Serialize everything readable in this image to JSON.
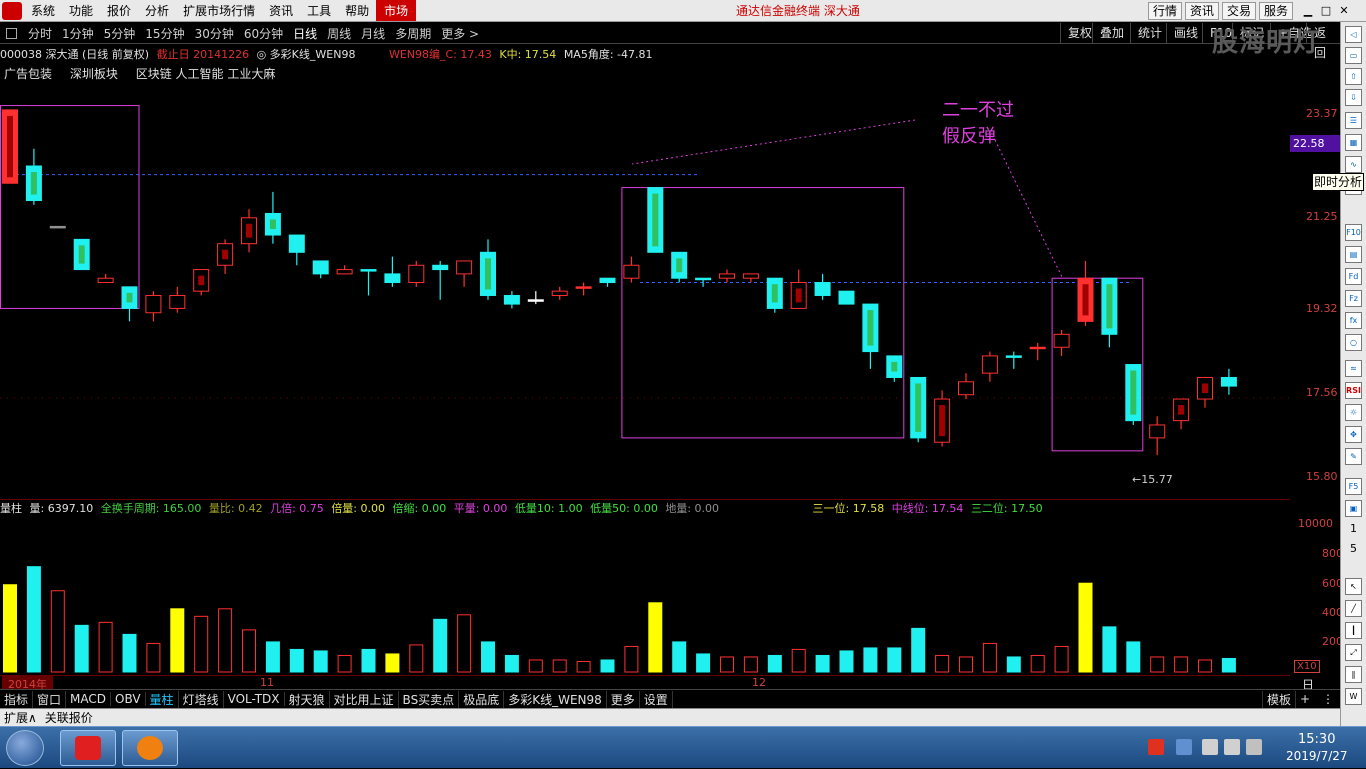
{
  "menu": {
    "items": [
      "系统",
      "功能",
      "报价",
      "分析",
      "扩展市场行情",
      "资讯",
      "工具",
      "帮助"
    ],
    "active_item": "市场",
    "brand": "通达信金融终端  深大通",
    "right_buttons": [
      "行情",
      "资讯",
      "交易",
      "服务"
    ]
  },
  "periods": {
    "items": [
      "分时",
      "1分钟",
      "5分钟",
      "15分钟",
      "30分钟",
      "60分钟",
      "日线",
      "周线",
      "月线",
      "多周期",
      "更多 >"
    ],
    "active": "日线",
    "right": [
      "复权",
      "叠加",
      "统计",
      "画线",
      "F10",
      "标记",
      "+自选",
      "返回"
    ]
  },
  "info": {
    "code_name": "000038 深大通 (日线 前复权)",
    "cutoff": "截止日 20141226",
    "indicator": "◎ 多彩K线_WEN98",
    "close_label": "WEN98编_C: 17.43",
    "kmid_label": "K中: 17.54",
    "ma5_label": "MA5角度: -47.81"
  },
  "blocks": [
    "广告包装",
    "深圳板块",
    "区块链 人工智能 工业大麻"
  ],
  "watermark": "股海明灯",
  "annotation": {
    "line1": "二一不过",
    "line2": "假反弹"
  },
  "price_axis": [
    "23.37",
    "21.25",
    "19.32",
    "17.56",
    "15.80"
  ],
  "current_price_tag": "22.58",
  "low_label": "←15.77",
  "volume_info": {
    "name": "量柱",
    "vol": "量: 6397.10",
    "full_turnover": "全换手周期: 165.00",
    "vol_ratio": "量比: 0.42",
    "multiple": "几倍: 0.75",
    "double": "倍量: 0.00",
    "half": "倍缩: 0.00",
    "flat": "平量: 0.00",
    "low10": "低量10: 1.00",
    "low50": "低量50: 0.00",
    "ground": "地量: 0.00",
    "third1": "三一位: 17.58",
    "mid": "中线位: 17.54",
    "third2": "三二位: 17.50"
  },
  "volume_axis": [
    "10000",
    "800",
    "600",
    "400",
    "200"
  ],
  "volume_axis_unit": "X10",
  "date_labels": {
    "year": "2014年",
    "m11": "11",
    "m12": "12",
    "period": "日线"
  },
  "tabs": [
    "指标",
    "窗口",
    "MACD",
    "OBV",
    "量柱",
    "灯塔线",
    "VOL-TDX",
    "射天狼",
    "对比用上证",
    "BS买卖点",
    "极品底",
    "多彩K线_WEN98",
    "更多",
    "设置"
  ],
  "active_tab": "量柱",
  "tabs_right": "模板",
  "ext_bar": [
    "扩展∧",
    "关联报价"
  ],
  "tooltip": "即时分析",
  "clock": {
    "time": "15:30",
    "date": "2019/7/27"
  },
  "chart_data": {
    "type": "candlestick",
    "ylim": [
      15.0,
      24.5
    ],
    "candles": [
      {
        "o": 22.2,
        "c": 23.9,
        "h": 23.9,
        "l": 22.2,
        "color": "red"
      },
      {
        "o": 22.6,
        "c": 21.8,
        "h": 23.0,
        "l": 21.7,
        "color": "cyan"
      },
      {
        "o": 21.2,
        "c": 21.2,
        "h": 21.2,
        "l": 21.2,
        "color": "gray"
      },
      {
        "o": 20.9,
        "c": 20.2,
        "h": 20.9,
        "l": 20.2,
        "color": "cyan"
      },
      {
        "o": 19.9,
        "c": 20.0,
        "h": 20.1,
        "l": 19.9,
        "color": "red"
      },
      {
        "o": 19.8,
        "c": 19.3,
        "h": 19.8,
        "l": 19.0,
        "color": "cyan"
      },
      {
        "o": 19.2,
        "c": 19.6,
        "h": 19.7,
        "l": 19.0,
        "color": "red"
      },
      {
        "o": 19.3,
        "c": 19.6,
        "h": 19.8,
        "l": 19.2,
        "color": "red"
      },
      {
        "o": 19.7,
        "c": 20.2,
        "h": 20.2,
        "l": 19.6,
        "color": "red"
      },
      {
        "o": 20.3,
        "c": 20.8,
        "h": 20.9,
        "l": 20.1,
        "color": "red"
      },
      {
        "o": 20.8,
        "c": 21.4,
        "h": 21.6,
        "l": 20.6,
        "color": "red"
      },
      {
        "o": 21.5,
        "c": 21.0,
        "h": 22.0,
        "l": 20.8,
        "color": "cyan"
      },
      {
        "o": 21.0,
        "c": 20.6,
        "h": 21.0,
        "l": 20.3,
        "color": "cyan"
      },
      {
        "o": 20.4,
        "c": 20.1,
        "h": 20.4,
        "l": 20.0,
        "color": "cyan"
      },
      {
        "o": 20.1,
        "c": 20.2,
        "h": 20.3,
        "l": 20.1,
        "color": "red"
      },
      {
        "o": 20.2,
        "c": 20.2,
        "h": 20.2,
        "l": 19.6,
        "color": "cyan"
      },
      {
        "o": 20.1,
        "c": 19.9,
        "h": 20.5,
        "l": 19.8,
        "color": "cyan"
      },
      {
        "o": 19.9,
        "c": 20.3,
        "h": 20.4,
        "l": 19.8,
        "color": "red"
      },
      {
        "o": 20.3,
        "c": 20.2,
        "h": 20.4,
        "l": 19.5,
        "color": "cyan"
      },
      {
        "o": 20.1,
        "c": 20.4,
        "h": 20.4,
        "l": 19.8,
        "color": "red"
      },
      {
        "o": 20.6,
        "c": 19.6,
        "h": 20.9,
        "l": 19.5,
        "color": "cyan"
      },
      {
        "o": 19.6,
        "c": 19.4,
        "h": 19.7,
        "l": 19.3,
        "color": "cyan"
      },
      {
        "o": 19.5,
        "c": 19.5,
        "h": 19.7,
        "l": 19.4,
        "color": "white"
      },
      {
        "o": 19.6,
        "c": 19.7,
        "h": 19.8,
        "l": 19.5,
        "color": "red"
      },
      {
        "o": 19.8,
        "c": 19.8,
        "h": 19.9,
        "l": 19.6,
        "color": "red"
      },
      {
        "o": 19.9,
        "c": 20.0,
        "h": 20.0,
        "l": 19.8,
        "color": "cyan"
      },
      {
        "o": 20.0,
        "c": 20.3,
        "h": 20.5,
        "l": 19.9,
        "color": "red"
      },
      {
        "o": 20.6,
        "c": 22.1,
        "h": 22.1,
        "l": 20.6,
        "color": "cyan"
      },
      {
        "o": 20.6,
        "c": 20.0,
        "h": 20.6,
        "l": 19.9,
        "color": "cyan"
      },
      {
        "o": 20.0,
        "c": 20.0,
        "h": 20.0,
        "l": 19.8,
        "color": "cyan"
      },
      {
        "o": 20.0,
        "c": 20.1,
        "h": 20.2,
        "l": 19.9,
        "color": "red"
      },
      {
        "o": 20.0,
        "c": 20.1,
        "h": 20.1,
        "l": 19.9,
        "color": "red"
      },
      {
        "o": 20.0,
        "c": 19.3,
        "h": 20.0,
        "l": 19.2,
        "color": "cyan"
      },
      {
        "o": 19.3,
        "c": 19.9,
        "h": 20.2,
        "l": 19.3,
        "color": "red"
      },
      {
        "o": 19.9,
        "c": 19.6,
        "h": 20.1,
        "l": 19.5,
        "color": "cyan"
      },
      {
        "o": 19.7,
        "c": 19.4,
        "h": 19.7,
        "l": 19.4,
        "color": "cyan"
      },
      {
        "o": 19.4,
        "c": 18.3,
        "h": 19.4,
        "l": 17.9,
        "color": "cyan"
      },
      {
        "o": 18.2,
        "c": 17.7,
        "h": 18.2,
        "l": 17.6,
        "color": "cyan"
      },
      {
        "o": 17.7,
        "c": 16.3,
        "h": 17.7,
        "l": 16.2,
        "color": "cyan"
      },
      {
        "o": 16.2,
        "c": 17.2,
        "h": 17.4,
        "l": 16.1,
        "color": "red"
      },
      {
        "o": 17.3,
        "c": 17.6,
        "h": 17.8,
        "l": 17.2,
        "color": "red"
      },
      {
        "o": 17.8,
        "c": 18.2,
        "h": 18.3,
        "l": 17.6,
        "color": "red"
      },
      {
        "o": 18.2,
        "c": 18.2,
        "h": 18.3,
        "l": 17.9,
        "color": "cyan"
      },
      {
        "o": 18.4,
        "c": 18.4,
        "h": 18.5,
        "l": 18.1,
        "color": "red"
      },
      {
        "o": 18.4,
        "c": 18.7,
        "h": 18.8,
        "l": 18.2,
        "color": "red"
      },
      {
        "o": 19.0,
        "c": 20.0,
        "h": 20.4,
        "l": 18.9,
        "color": "red"
      },
      {
        "o": 20.0,
        "c": 18.7,
        "h": 20.0,
        "l": 18.4,
        "color": "cyan"
      },
      {
        "o": 18.0,
        "c": 16.7,
        "h": 18.0,
        "l": 16.6,
        "color": "cyan"
      },
      {
        "o": 16.3,
        "c": 16.6,
        "h": 16.8,
        "l": 15.9,
        "color": "red"
      },
      {
        "o": 16.7,
        "c": 17.2,
        "h": 17.2,
        "l": 16.5,
        "color": "red"
      },
      {
        "o": 17.2,
        "c": 17.7,
        "h": 17.7,
        "l": 17.0,
        "color": "red"
      },
      {
        "o": 17.7,
        "c": 17.5,
        "h": 17.9,
        "l": 17.3,
        "color": "cyan"
      }
    ],
    "volumes": [
      580,
      700,
      540,
      310,
      330,
      250,
      190,
      420,
      370,
      420,
      280,
      200,
      150,
      140,
      110,
      150,
      120,
      180,
      350,
      380,
      200,
      110,
      80,
      80,
      70,
      80,
      170,
      460,
      200,
      120,
      100,
      100,
      110,
      150,
      110,
      140,
      160,
      160,
      290,
      110,
      100,
      190,
      100,
      110,
      170,
      590,
      300,
      200,
      100,
      100,
      80,
      90
    ],
    "volume_ylim": [
      0,
      1050
    ],
    "dashed_levels": [
      22.4,
      19.9,
      17.3
    ],
    "boxes": [
      {
        "i0": 0,
        "i1": 5,
        "top": 24.0,
        "bottom": 19.3
      },
      {
        "i0": 26,
        "i1": 37,
        "top": 22.1,
        "bottom": 16.3
      },
      {
        "i0": 44,
        "i1": 47,
        "top": 20.0,
        "bottom": 16.0
      }
    ]
  }
}
